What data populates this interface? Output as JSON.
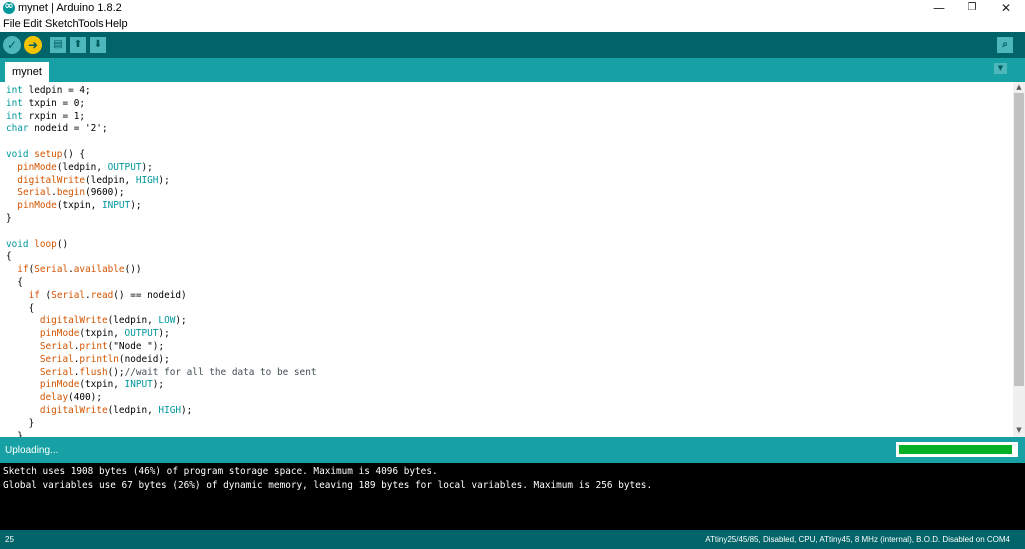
{
  "window": {
    "title": "mynet | Arduino 1.8.2",
    "logo_icon": "arduino-infinity-icon",
    "minimize_icon": "minimize-icon",
    "maximize_icon": "restore-icon",
    "close_icon": "close-icon"
  },
  "menu": {
    "items": [
      "File",
      "Edit",
      "Sketch",
      "Tools",
      "Help"
    ]
  },
  "toolbar": {
    "verify_icon": "checkmark-icon",
    "upload_icon": "arrow-right-icon",
    "new_icon": "new-file-icon",
    "open_icon": "arrow-up-icon",
    "save_icon": "arrow-down-icon",
    "serial_monitor_icon": "magnifier-icon"
  },
  "tabs": {
    "active": "mynet",
    "menu_icon": "chevron-down-icon"
  },
  "editor": {
    "lines": [
      [
        {
          "t": "int",
          "c": "kw"
        },
        {
          "t": " ledpin = 4;"
        }
      ],
      [
        {
          "t": "int",
          "c": "kw"
        },
        {
          "t": " txpin = 0;"
        }
      ],
      [
        {
          "t": "int",
          "c": "kw"
        },
        {
          "t": " rxpin = 1;"
        }
      ],
      [
        {
          "t": "char",
          "c": "kw"
        },
        {
          "t": " nodeid = '2';"
        }
      ],
      [],
      [
        {
          "t": "void",
          "c": "kw"
        },
        {
          "t": " "
        },
        {
          "t": "setup",
          "c": "fn"
        },
        {
          "t": "() {"
        }
      ],
      [
        {
          "t": "  "
        },
        {
          "t": "pinMode",
          "c": "fn"
        },
        {
          "t": "(ledpin, "
        },
        {
          "t": "OUTPUT",
          "c": "kw"
        },
        {
          "t": ");"
        }
      ],
      [
        {
          "t": "  "
        },
        {
          "t": "digitalWrite",
          "c": "fn"
        },
        {
          "t": "(ledpin, "
        },
        {
          "t": "HIGH",
          "c": "kw"
        },
        {
          "t": ");"
        }
      ],
      [
        {
          "t": "  "
        },
        {
          "t": "Serial",
          "c": "fn"
        },
        {
          "t": "."
        },
        {
          "t": "begin",
          "c": "fn"
        },
        {
          "t": "(9600);"
        }
      ],
      [
        {
          "t": "  "
        },
        {
          "t": "pinMode",
          "c": "fn"
        },
        {
          "t": "(txpin, "
        },
        {
          "t": "INPUT",
          "c": "kw"
        },
        {
          "t": ");"
        }
      ],
      [
        {
          "t": "}"
        }
      ],
      [],
      [
        {
          "t": "void",
          "c": "kw"
        },
        {
          "t": " "
        },
        {
          "t": "loop",
          "c": "fn"
        },
        {
          "t": "()"
        }
      ],
      [
        {
          "t": "{"
        }
      ],
      [
        {
          "t": "  "
        },
        {
          "t": "if",
          "c": "fn"
        },
        {
          "t": "("
        },
        {
          "t": "Serial",
          "c": "fn"
        },
        {
          "t": "."
        },
        {
          "t": "available",
          "c": "fn"
        },
        {
          "t": "())"
        }
      ],
      [
        {
          "t": "  {"
        }
      ],
      [
        {
          "t": "    "
        },
        {
          "t": "if",
          "c": "fn"
        },
        {
          "t": " ("
        },
        {
          "t": "Serial",
          "c": "fn"
        },
        {
          "t": "."
        },
        {
          "t": "read",
          "c": "fn"
        },
        {
          "t": "() == nodeid)"
        }
      ],
      [
        {
          "t": "    {"
        }
      ],
      [
        {
          "t": "      "
        },
        {
          "t": "digitalWrite",
          "c": "fn"
        },
        {
          "t": "(ledpin, "
        },
        {
          "t": "LOW",
          "c": "kw"
        },
        {
          "t": ");"
        }
      ],
      [
        {
          "t": "      "
        },
        {
          "t": "pinMode",
          "c": "fn"
        },
        {
          "t": "(txpin, "
        },
        {
          "t": "OUTPUT",
          "c": "kw"
        },
        {
          "t": ");"
        }
      ],
      [
        {
          "t": "      "
        },
        {
          "t": "Serial",
          "c": "fn"
        },
        {
          "t": "."
        },
        {
          "t": "print",
          "c": "fn"
        },
        {
          "t": "(\"Node \");"
        }
      ],
      [
        {
          "t": "      "
        },
        {
          "t": "Serial",
          "c": "fn"
        },
        {
          "t": "."
        },
        {
          "t": "println",
          "c": "fn"
        },
        {
          "t": "(nodeid);"
        }
      ],
      [
        {
          "t": "      "
        },
        {
          "t": "Serial",
          "c": "fn"
        },
        {
          "t": "."
        },
        {
          "t": "flush",
          "c": "fn"
        },
        {
          "t": "();"
        },
        {
          "t": "//wait for all the data to be sent",
          "c": "cm"
        }
      ],
      [
        {
          "t": "      "
        },
        {
          "t": "pinMode",
          "c": "fn"
        },
        {
          "t": "(txpin, "
        },
        {
          "t": "INPUT",
          "c": "kw"
        },
        {
          "t": ");"
        }
      ],
      [
        {
          "t": "      "
        },
        {
          "t": "delay",
          "c": "fn"
        },
        {
          "t": "(400);"
        }
      ],
      [
        {
          "t": "      "
        },
        {
          "t": "digitalWrite",
          "c": "fn"
        },
        {
          "t": "(ledpin, "
        },
        {
          "t": "HIGH",
          "c": "kw"
        },
        {
          "t": ");"
        }
      ],
      [
        {
          "t": "    }"
        }
      ],
      [
        {
          "t": "  }"
        }
      ]
    ]
  },
  "status": {
    "message": "Uploading...",
    "progress_fraction": 0.97,
    "progress_color": "#06b025"
  },
  "console": {
    "lines": [
      "Sketch uses 1908 bytes (46%) of program storage space. Maximum is 4096 bytes.",
      "Global variables use 67 bytes (26%) of dynamic memory, leaving 189 bytes for local variables. Maximum is 256 bytes."
    ]
  },
  "footer": {
    "line_number": "25",
    "board_info": "ATtiny25/45/85, Disabled, CPU, ATtiny45, 8 MHz (internal), B.O.D. Disabled on COM4"
  },
  "colors": {
    "toolbar": "#006468",
    "tabbar": "#17a1a5",
    "keyword": "#00979c",
    "function": "#d35400",
    "upload_button": "#f4c400"
  }
}
